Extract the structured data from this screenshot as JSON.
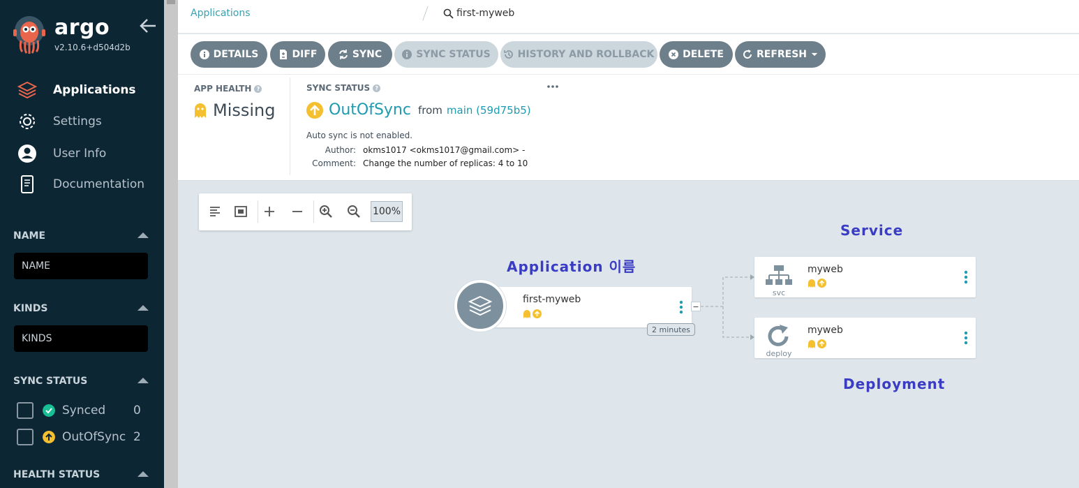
{
  "sidebar": {
    "brand": "argo",
    "version": "v2.10.6+d504d2b",
    "nav": [
      {
        "label": "Applications",
        "icon": "layers-icon"
      },
      {
        "label": "Settings",
        "icon": "gear-icon"
      },
      {
        "label": "User Info",
        "icon": "user-icon"
      },
      {
        "label": "Documentation",
        "icon": "book-icon"
      }
    ],
    "filters": {
      "name_title": "NAME",
      "name_placeholder": "NAME",
      "kinds_title": "KINDS",
      "kinds_placeholder": "KINDS",
      "sync_title": "SYNC STATUS",
      "sync_items": [
        {
          "label": "Synced",
          "count": "0",
          "color": "#18be94"
        },
        {
          "label": "OutOfSync",
          "count": "2",
          "color": "#f4c030"
        }
      ],
      "health_title": "HEALTH STATUS"
    }
  },
  "breadcrumb": {
    "root": "Applications",
    "current": "first-myweb"
  },
  "actions": [
    {
      "label": "DETAILS",
      "icon": "info-icon",
      "enabled": true
    },
    {
      "label": "DIFF",
      "icon": "file-diff-icon",
      "enabled": true
    },
    {
      "label": "SYNC",
      "icon": "sync-icon",
      "enabled": true
    },
    {
      "label": "SYNC STATUS",
      "icon": "info-icon",
      "enabled": false
    },
    {
      "label": "HISTORY AND ROLLBACK",
      "icon": "history-icon",
      "enabled": false
    },
    {
      "label": "DELETE",
      "icon": "close-circle-icon",
      "enabled": true
    },
    {
      "label": "REFRESH",
      "icon": "refresh-icon",
      "enabled": true
    }
  ],
  "status": {
    "health_title": "APP HEALTH",
    "health_value": "Missing",
    "sync_title": "SYNC STATUS",
    "sync_value": "OutOfSync",
    "from_label": "from",
    "revision": "main (59d75b5)",
    "auto_sync": "Auto sync is not enabled.",
    "author_label": "Author:",
    "author": "okms1017 <okms1017@gmail.com> -",
    "comment_label": "Comment:",
    "comment": "Change the number of replicas: 4 to 10"
  },
  "graph": {
    "zoom": "100%",
    "app_node": {
      "name": "first-myweb",
      "age": "2 minutes"
    },
    "service_node": {
      "name": "myweb",
      "kind": "svc"
    },
    "deploy_node": {
      "name": "myweb",
      "kind": "deploy"
    },
    "annotations": {
      "application": "Application 이름",
      "service": "Service",
      "deployment": "Deployment"
    }
  },
  "colors": {
    "sidebar_bg": "#0c2634",
    "accent": "#1d9bb0",
    "missing": "#f4c030",
    "out_of_sync": "#f4c030",
    "synced": "#18be94",
    "annotation": "#3a3cc4"
  }
}
